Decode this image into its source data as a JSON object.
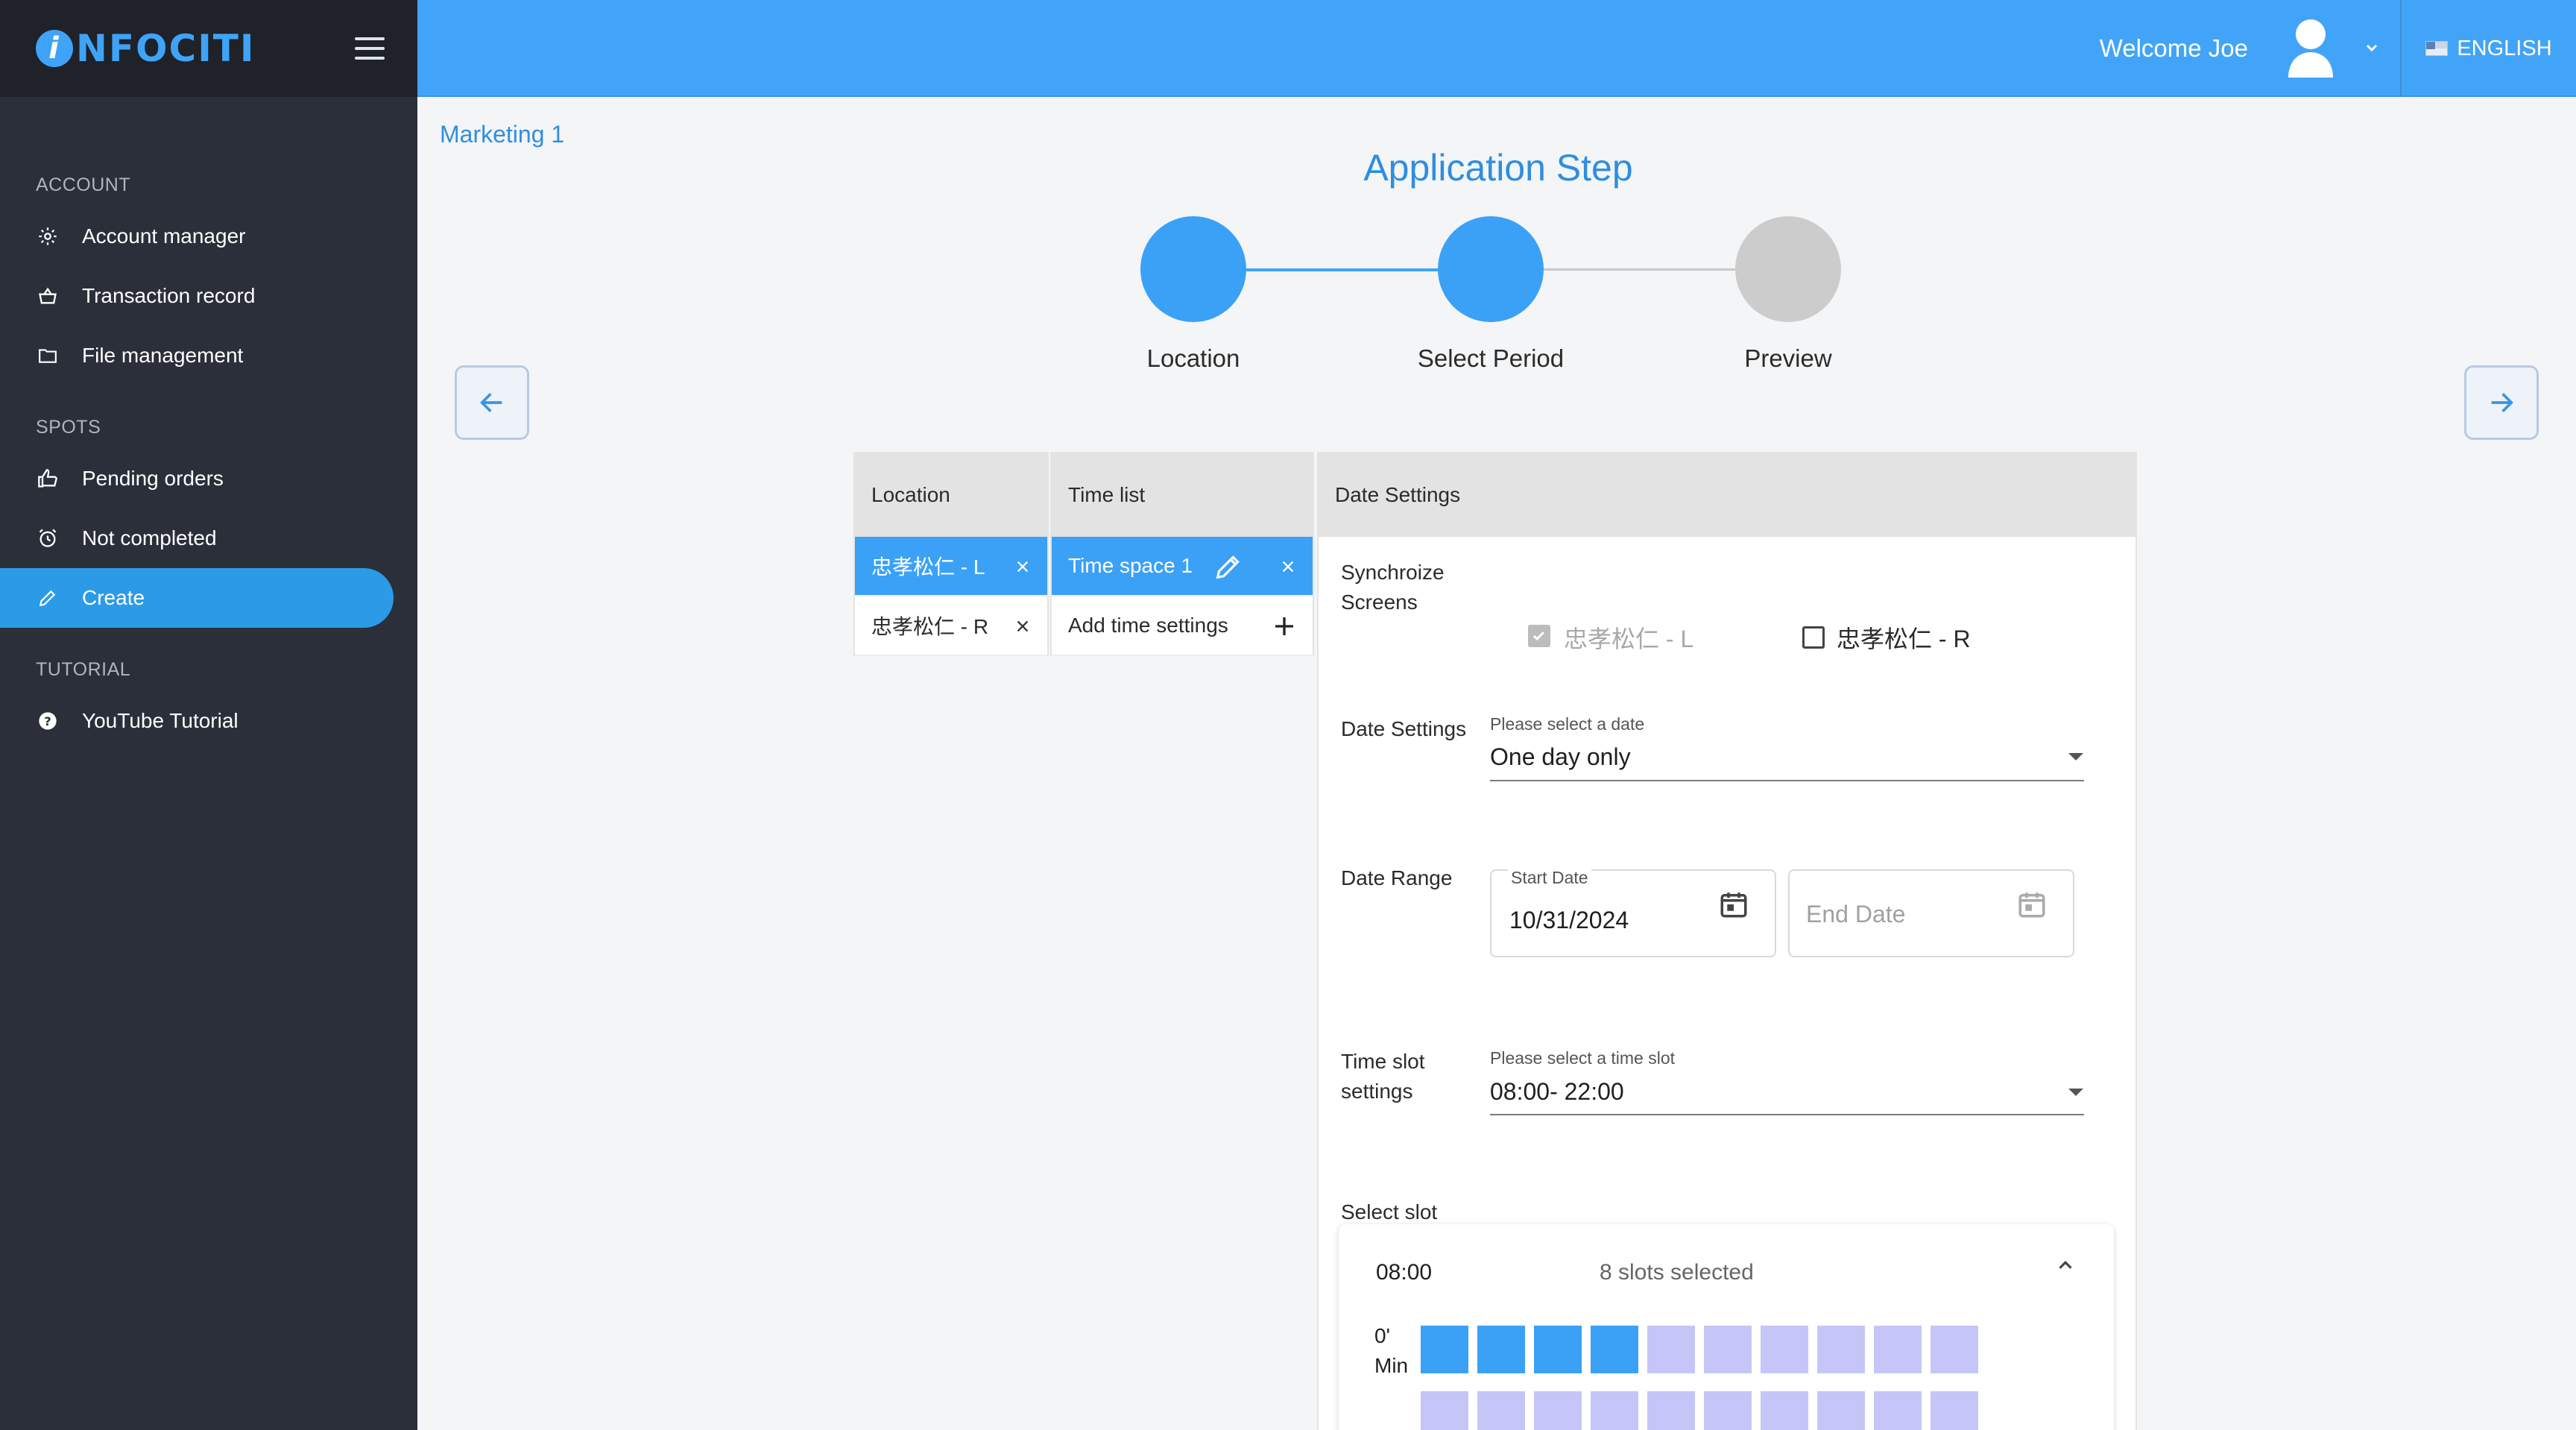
{
  "brand": {
    "logo_text": "NFOCITI",
    "logo_initial": "i"
  },
  "sidebar": {
    "sections": [
      {
        "title": "ACCOUNT",
        "items": [
          {
            "label": "Account manager",
            "icon": "gear-icon"
          },
          {
            "label": "Transaction record",
            "icon": "basket-icon"
          },
          {
            "label": "File management",
            "icon": "folder-icon"
          }
        ]
      },
      {
        "title": "SPOTS",
        "items": [
          {
            "label": "Pending orders",
            "icon": "thumbs-up-icon"
          },
          {
            "label": "Not completed",
            "icon": "alarm-clock-icon"
          },
          {
            "label": "Create",
            "icon": "pencil-icon",
            "active": true
          }
        ]
      },
      {
        "title": "TUTORIAL",
        "items": [
          {
            "label": "YouTube Tutorial",
            "icon": "help-circle-icon"
          }
        ]
      }
    ]
  },
  "header": {
    "welcome": "Welcome Joe",
    "language": "ENGLISH"
  },
  "breadcrumb": "Marketing 1",
  "step_title": "Application Step",
  "steps": [
    {
      "label": "Location",
      "state": "done"
    },
    {
      "label": "Select Period",
      "state": "current"
    },
    {
      "label": "Preview",
      "state": "pending"
    }
  ],
  "location_panel": {
    "header": "Location",
    "items": [
      {
        "label": "忠孝松仁 - L",
        "selected": true
      },
      {
        "label": "忠孝松仁 - R",
        "selected": false
      }
    ]
  },
  "time_panel": {
    "header": "Time list",
    "items": [
      {
        "label": "Time space 1",
        "selected": true
      }
    ],
    "add_label": "Add time settings"
  },
  "date_panel": {
    "header": "Date Settings",
    "sync_label_1": "Synchroize",
    "sync_label_2": "Screens",
    "screens": [
      {
        "label": "忠孝松仁 - L",
        "checked": true,
        "disabled": true
      },
      {
        "label": "忠孝松仁 - R",
        "checked": false,
        "disabled": false
      }
    ],
    "date_settings_label": "Date Settings",
    "date_settings_caption": "Please select a date",
    "date_settings_value": "One day only",
    "date_range_label": "Date Range",
    "start_date_caption": "Start Date",
    "start_date_value": "10/31/2024",
    "end_date_placeholder": "End Date",
    "time_slot_label_1": "Time slot",
    "time_slot_label_2": "settings",
    "time_slot_caption": "Please select a time slot",
    "time_slot_value": "08:00- 22:00",
    "select_slot_label": "Select slot"
  },
  "slot_card": {
    "hour": "08:00",
    "summary": "8 slots selected",
    "row_label_1": "0'",
    "row_label_2": "Min",
    "rows": [
      [
        true,
        true,
        true,
        true,
        false,
        false,
        false,
        false,
        false,
        false
      ],
      [
        false,
        false,
        false,
        false,
        false,
        false,
        false,
        false,
        false,
        false
      ]
    ]
  },
  "colors": {
    "primary": "#42a4f8",
    "sidebar_bg": "#2b2f3a",
    "active_nav": "#2b9be8",
    "slot_selected": "#3aa1f7",
    "slot_unselected": "#c5c6f7",
    "step_pending": "#cccccc"
  }
}
